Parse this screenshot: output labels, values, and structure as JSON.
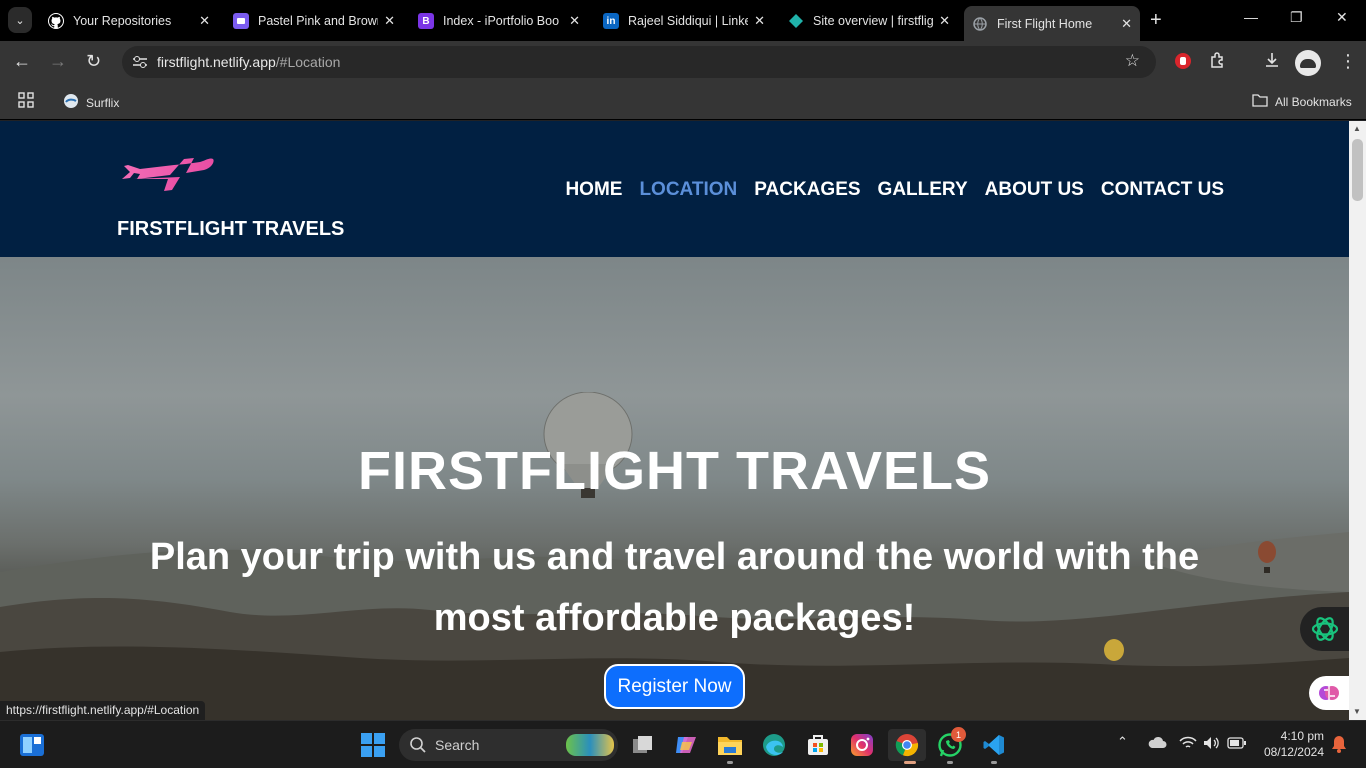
{
  "browser": {
    "tabs": [
      {
        "title": "Your Repositories",
        "icon": "github-icon",
        "color": "#ffffff",
        "glyph": ""
      },
      {
        "title": "Pastel Pink and Brown",
        "icon": "canva-icon",
        "color": "#7b5cf0",
        "glyph": ""
      },
      {
        "title": "Index - iPortfolio Boo",
        "icon": "bootstrap-icon",
        "color": "#7b35e6",
        "glyph": "B"
      },
      {
        "title": "Rajeel Siddiqui | Linke",
        "icon": "linkedin-icon",
        "color": "#0a66c2",
        "glyph": "in"
      },
      {
        "title": "Site overview | firstflig",
        "icon": "netlify-icon",
        "color": "#20b2aa",
        "glyph": ""
      },
      {
        "title": "First Flight Home",
        "icon": "globe-icon",
        "color": "#9aa0a6",
        "glyph": ""
      }
    ],
    "active_tab": 5,
    "url_host": "firstflight.netlify.app",
    "url_path": "/#Location",
    "bookmarks": {
      "item": "Surflix",
      "all": "All Bookmarks"
    },
    "status_url": "https://firstflight.netlify.app/#Location"
  },
  "site": {
    "brand": "FIRSTFLIGHT TRAVELS",
    "nav": [
      "HOME",
      "LOCATION",
      "PACKAGES",
      "GALLERY",
      "ABOUT US",
      "CONTACT US"
    ],
    "nav_active": "LOCATION",
    "hero_title": "FIRSTFLIGHT TRAVELS",
    "hero_subtitle": "Plan your trip with us and travel around the world with the most affordable packages!",
    "cta": "Register Now",
    "colors": {
      "navbar": "#012042",
      "active_link": "#5b8fd9",
      "cta": "#0d6efd",
      "logo": "#f06bb6"
    }
  },
  "taskbar": {
    "search_label": "Search",
    "whatsapp_badge": "1",
    "time": "4:10 pm",
    "date": "08/12/2024"
  }
}
